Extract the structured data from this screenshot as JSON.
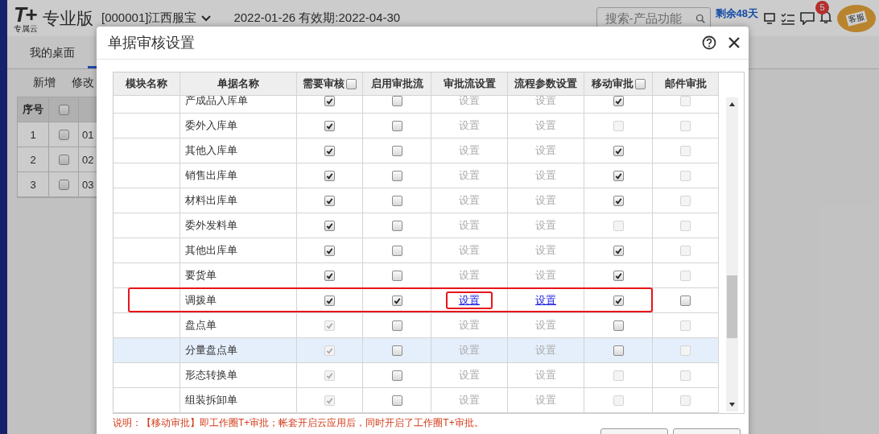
{
  "app": {
    "logo": "T+",
    "logo_sub": "专属云",
    "edition": "专业版",
    "account": "[000001]江西服宝",
    "dates": "2022-01-26  有效期:2022-04-30",
    "search": {
      "placeholder": "搜索-产品功能"
    },
    "remaining": "剩余48天",
    "notification_count": "5",
    "service_label": "客服"
  },
  "tabs": [
    {
      "label": "我的桌面",
      "selected": false
    }
  ],
  "toolbar": [
    "新增",
    "修改"
  ],
  "grid": {
    "columns": [
      "序号"
    ],
    "header_checked": false,
    "rows": [
      {
        "index": "1",
        "checked": false,
        "code": "01"
      },
      {
        "index": "2",
        "checked": false,
        "code": "02"
      },
      {
        "index": "3",
        "checked": false,
        "code": "03"
      }
    ]
  },
  "dialog": {
    "title": "单据审核设置",
    "columns": [
      {
        "label": "模块名称",
        "kind": "plain"
      },
      {
        "label": "单据名称",
        "kind": "plain"
      },
      {
        "label": "需要审核",
        "kind": "check",
        "checked": false
      },
      {
        "label": "启用审批流",
        "kind": "plain"
      },
      {
        "label": "审批流设置",
        "kind": "plain"
      },
      {
        "label": "流程参数设置",
        "kind": "plain"
      },
      {
        "label": "移动审批",
        "kind": "check",
        "checked": false
      },
      {
        "label": "邮件审批",
        "kind": "plain"
      }
    ],
    "rows": [
      {
        "name": "产成品入库单",
        "selected": false,
        "marked": false,
        "audit": {
          "checked": true,
          "disabled": false
        },
        "flow": {
          "checked": false,
          "disabled": false
        },
        "flow_setting": {
          "label": "设置",
          "enabled": false,
          "marked": false
        },
        "param_setting": {
          "label": "设置",
          "enabled": false
        },
        "mobile": {
          "checked": true,
          "disabled": false
        },
        "email": {
          "checked": false,
          "disabled": true
        }
      },
      {
        "name": "委外入库单",
        "selected": false,
        "marked": false,
        "audit": {
          "checked": true,
          "disabled": false
        },
        "flow": {
          "checked": false,
          "disabled": false
        },
        "flow_setting": {
          "label": "设置",
          "enabled": false,
          "marked": false
        },
        "param_setting": {
          "label": "设置",
          "enabled": false
        },
        "mobile": {
          "checked": false,
          "disabled": true
        },
        "email": {
          "checked": false,
          "disabled": true
        }
      },
      {
        "name": "其他入库单",
        "selected": false,
        "marked": false,
        "audit": {
          "checked": true,
          "disabled": false
        },
        "flow": {
          "checked": false,
          "disabled": false
        },
        "flow_setting": {
          "label": "设置",
          "enabled": false,
          "marked": false
        },
        "param_setting": {
          "label": "设置",
          "enabled": false
        },
        "mobile": {
          "checked": true,
          "disabled": false
        },
        "email": {
          "checked": false,
          "disabled": true
        }
      },
      {
        "name": "销售出库单",
        "selected": false,
        "marked": false,
        "audit": {
          "checked": true,
          "disabled": false
        },
        "flow": {
          "checked": false,
          "disabled": false
        },
        "flow_setting": {
          "label": "设置",
          "enabled": false,
          "marked": false
        },
        "param_setting": {
          "label": "设置",
          "enabled": false
        },
        "mobile": {
          "checked": true,
          "disabled": false
        },
        "email": {
          "checked": false,
          "disabled": true
        }
      },
      {
        "name": "材料出库单",
        "selected": false,
        "marked": false,
        "audit": {
          "checked": true,
          "disabled": false
        },
        "flow": {
          "checked": false,
          "disabled": false
        },
        "flow_setting": {
          "label": "设置",
          "enabled": false,
          "marked": false
        },
        "param_setting": {
          "label": "设置",
          "enabled": false
        },
        "mobile": {
          "checked": true,
          "disabled": false
        },
        "email": {
          "checked": false,
          "disabled": true
        }
      },
      {
        "name": "委外发料单",
        "selected": false,
        "marked": false,
        "audit": {
          "checked": true,
          "disabled": false
        },
        "flow": {
          "checked": false,
          "disabled": false
        },
        "flow_setting": {
          "label": "设置",
          "enabled": false,
          "marked": false
        },
        "param_setting": {
          "label": "设置",
          "enabled": false
        },
        "mobile": {
          "checked": false,
          "disabled": true
        },
        "email": {
          "checked": false,
          "disabled": true
        }
      },
      {
        "name": "其他出库单",
        "selected": false,
        "marked": false,
        "audit": {
          "checked": true,
          "disabled": false
        },
        "flow": {
          "checked": false,
          "disabled": false
        },
        "flow_setting": {
          "label": "设置",
          "enabled": false,
          "marked": false
        },
        "param_setting": {
          "label": "设置",
          "enabled": false
        },
        "mobile": {
          "checked": true,
          "disabled": false
        },
        "email": {
          "checked": false,
          "disabled": true
        }
      },
      {
        "name": "要货单",
        "selected": false,
        "marked": false,
        "audit": {
          "checked": true,
          "disabled": false
        },
        "flow": {
          "checked": false,
          "disabled": false
        },
        "flow_setting": {
          "label": "设置",
          "enabled": false,
          "marked": false
        },
        "param_setting": {
          "label": "设置",
          "enabled": false
        },
        "mobile": {
          "checked": true,
          "disabled": false
        },
        "email": {
          "checked": false,
          "disabled": true
        }
      },
      {
        "name": "调拨单",
        "selected": false,
        "marked": true,
        "audit": {
          "checked": true,
          "disabled": false
        },
        "flow": {
          "checked": true,
          "disabled": false
        },
        "flow_setting": {
          "label": "设置",
          "enabled": true,
          "marked": true
        },
        "param_setting": {
          "label": "设置",
          "enabled": true
        },
        "mobile": {
          "checked": true,
          "disabled": false
        },
        "email": {
          "checked": false,
          "disabled": false
        }
      },
      {
        "name": "盘点单",
        "selected": false,
        "marked": false,
        "audit": {
          "checked": true,
          "disabled": true
        },
        "flow": {
          "checked": false,
          "disabled": false
        },
        "flow_setting": {
          "label": "设置",
          "enabled": false,
          "marked": false
        },
        "param_setting": {
          "label": "设置",
          "enabled": false
        },
        "mobile": {
          "checked": false,
          "disabled": false
        },
        "email": {
          "checked": false,
          "disabled": true
        }
      },
      {
        "name": "分量盘点单",
        "selected": true,
        "marked": false,
        "audit": {
          "checked": true,
          "disabled": true
        },
        "flow": {
          "checked": false,
          "disabled": false
        },
        "flow_setting": {
          "label": "设置",
          "enabled": false,
          "marked": false
        },
        "param_setting": {
          "label": "设置",
          "enabled": false
        },
        "mobile": {
          "checked": false,
          "disabled": false
        },
        "email": {
          "checked": false,
          "disabled": true
        }
      },
      {
        "name": "形态转换单",
        "selected": false,
        "marked": false,
        "audit": {
          "checked": true,
          "disabled": true
        },
        "flow": {
          "checked": false,
          "disabled": false
        },
        "flow_setting": {
          "label": "设置",
          "enabled": false,
          "marked": false
        },
        "param_setting": {
          "label": "设置",
          "enabled": false
        },
        "mobile": {
          "checked": false,
          "disabled": true
        },
        "email": {
          "checked": false,
          "disabled": true
        }
      },
      {
        "name": "组装拆卸单",
        "selected": false,
        "marked": false,
        "audit": {
          "checked": true,
          "disabled": true
        },
        "flow": {
          "checked": false,
          "disabled": false
        },
        "flow_setting": {
          "label": "设置",
          "enabled": false,
          "marked": false
        },
        "param_setting": {
          "label": "设置",
          "enabled": false
        },
        "mobile": {
          "checked": false,
          "disabled": true
        },
        "email": {
          "checked": false,
          "disabled": true
        }
      }
    ],
    "note": "说明：【移动审批】即工作圈T+审批；帐套开启云应用后，同时开启了工作圈T+审批。"
  }
}
